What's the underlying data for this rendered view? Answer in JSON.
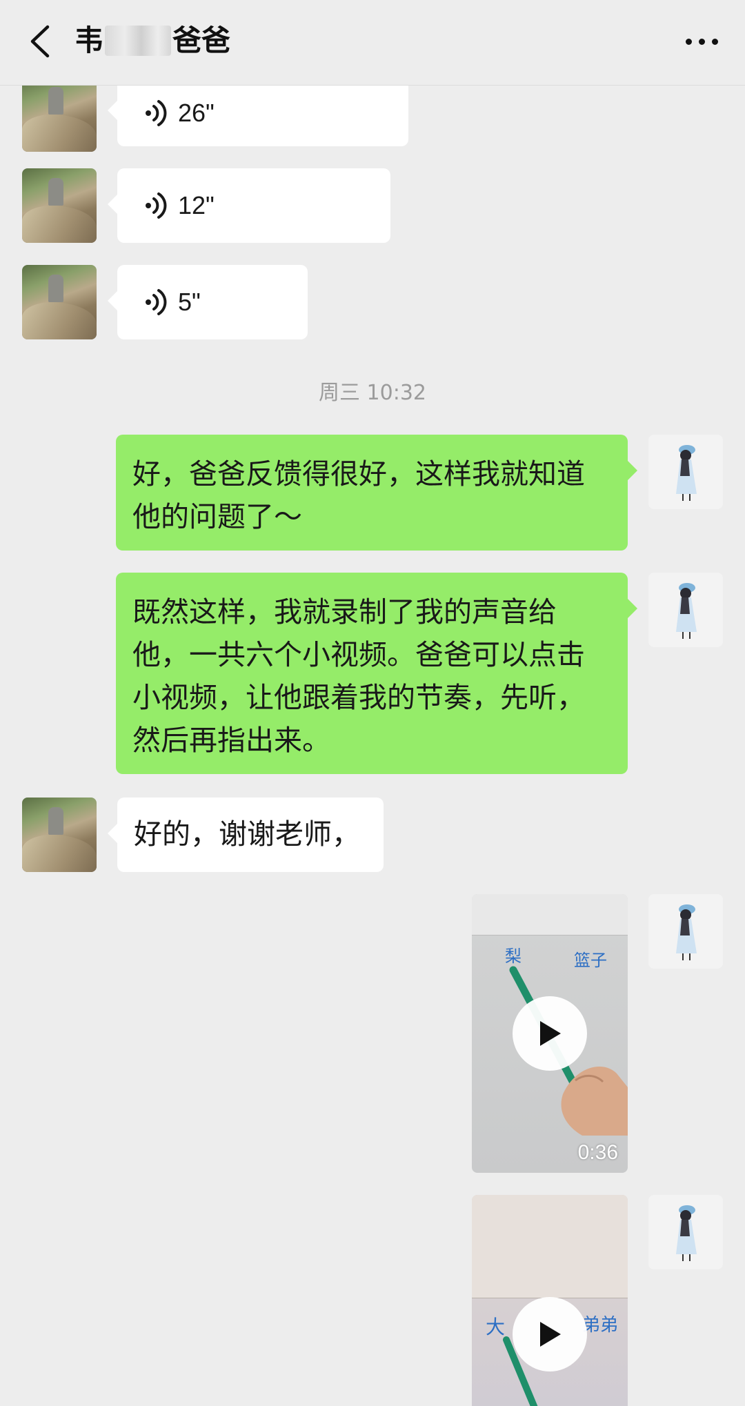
{
  "header": {
    "title_prefix": "韦",
    "title_suffix": "爸爸",
    "back_icon": "chevron-left-icon",
    "more_icon": "more-dots-icon"
  },
  "messages": {
    "voice1": {
      "duration": "26\""
    },
    "voice2": {
      "duration": "12\""
    },
    "voice3": {
      "duration": "5\""
    },
    "timestamp": "周三 10:32",
    "text1": "好，爸爸反馈得很好，这样我就知道他的问题了～",
    "text2": "既然这样，我就录制了我的声音给他，一共六个小视频。爸爸可以点击小视频，让他跟着我的节奏，先听，然后再指出来。",
    "text3": "好的，谢谢老师，",
    "video1": {
      "duration": "0:36",
      "words": [
        "梨",
        "篮子"
      ]
    },
    "video2": {
      "words": [
        "大",
        "弟弟"
      ]
    }
  },
  "colors": {
    "background": "#ededed",
    "sent_bubble": "#95ec69",
    "received_bubble": "#ffffff",
    "timestamp": "#9b9b9b"
  }
}
